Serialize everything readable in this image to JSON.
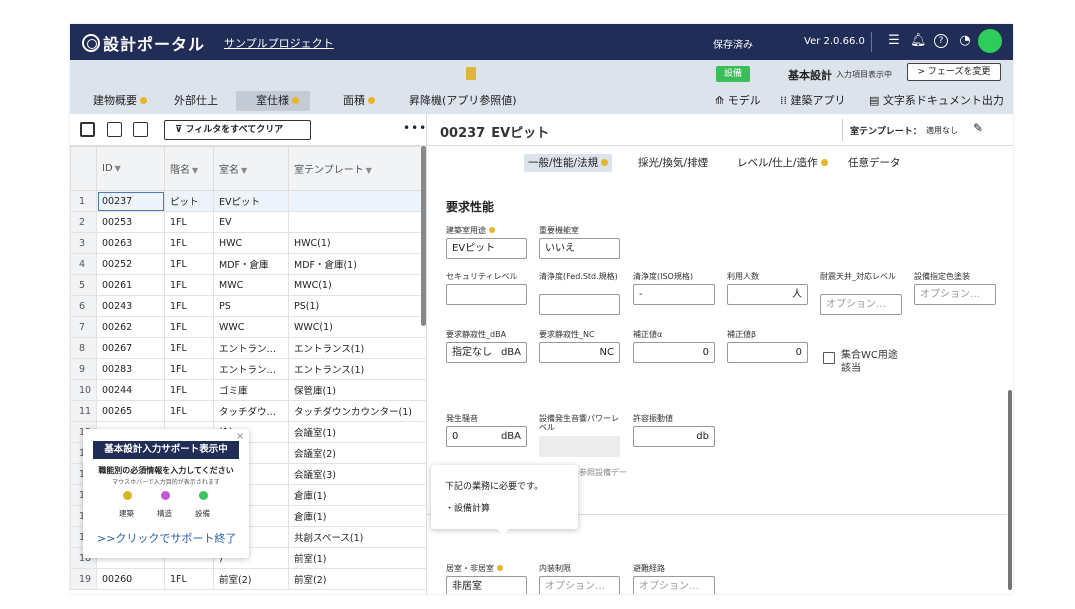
{
  "header": {
    "app_title": "設計ポータル",
    "project_link": "サンプルプロジェクト",
    "save_status": "保存済み",
    "version": "Ver 2.0.66.0",
    "icons": [
      "menu-icon",
      "bell-icon",
      "help-icon",
      "history-icon",
      "avatar"
    ]
  },
  "subheader": {
    "badge": "設備",
    "phase_title": "基本設計",
    "phase_sub": "入力項目表示中",
    "phase_button": "フェーズを変更",
    "tabs": [
      "建物概要",
      "外部仕上",
      "室仕様",
      "面積",
      "昇降機(アプリ参照値)"
    ],
    "active_tab": "室仕様",
    "links": [
      "モデル",
      "建築アプリ",
      "文字系ドキュメント出力"
    ]
  },
  "left_toolbar": {
    "filter_clear": "フィルタをすべてクリア",
    "more": "•••"
  },
  "table": {
    "columns": [
      "ID",
      "階名",
      "室名",
      "室テンプレート"
    ],
    "rows": [
      {
        "n": "1",
        "id": "00237",
        "floor": "ピット",
        "room": "EVピット",
        "template": ""
      },
      {
        "n": "2",
        "id": "00253",
        "floor": "1FL",
        "room": "EV",
        "template": ""
      },
      {
        "n": "3",
        "id": "00263",
        "floor": "1FL",
        "room": "HWC",
        "template": "HWC(1)"
      },
      {
        "n": "4",
        "id": "00252",
        "floor": "1FL",
        "room": "MDF・倉庫",
        "template": "MDF・倉庫(1)"
      },
      {
        "n": "5",
        "id": "00261",
        "floor": "1FL",
        "room": "MWC",
        "template": "MWC(1)"
      },
      {
        "n": "6",
        "id": "00243",
        "floor": "1FL",
        "room": "PS",
        "template": "PS(1)"
      },
      {
        "n": "7",
        "id": "00262",
        "floor": "1FL",
        "room": "WWC",
        "template": "WWC(1)"
      },
      {
        "n": "8",
        "id": "00267",
        "floor": "1FL",
        "room": "エントラン…",
        "template": "エントランス(1)"
      },
      {
        "n": "9",
        "id": "00283",
        "floor": "1FL",
        "room": "エントラン…",
        "template": "エントランス(1)"
      },
      {
        "n": "10",
        "id": "00244",
        "floor": "1FL",
        "room": "ゴミ庫",
        "template": "保管庫(1)"
      },
      {
        "n": "11",
        "id": "00265",
        "floor": "1FL",
        "room": "タッチダウ…",
        "template": "タッチダウンカウンター(1)"
      },
      {
        "n": "12",
        "id": "",
        "floor": "",
        "room": "(1)",
        "template": "会議室(1)"
      },
      {
        "n": "13",
        "id": "",
        "floor": "",
        "room": "(2)",
        "template": "会議室(2)"
      },
      {
        "n": "14",
        "id": "",
        "floor": "",
        "room": "(3)",
        "template": "会議室(3)"
      },
      {
        "n": "15",
        "id": "",
        "floor": "",
        "room": ")",
        "template": "倉庫(1)"
      },
      {
        "n": "16",
        "id": "",
        "floor": "",
        "room": ")",
        "template": "倉庫(1)"
      },
      {
        "n": "17",
        "id": "",
        "floor": "",
        "room": "ペース",
        "template": "共創スペース(1)"
      },
      {
        "n": "18",
        "id": "",
        "floor": "",
        "room": ")",
        "template": "前室(1)"
      },
      {
        "n": "19",
        "id": "00260",
        "floor": "1FL",
        "room": "前室(2)",
        "template": "前室(2)"
      }
    ]
  },
  "support_popup": {
    "close": "×",
    "title": "基本設計入力サポート表示中",
    "line1": "職能別の必須情報を入力してください",
    "line2": "マウスホバーで入力目的が表示されます",
    "legend": [
      {
        "label": "建築",
        "color": "#d9b52a"
      },
      {
        "label": "構造",
        "color": "#c25ad3"
      },
      {
        "label": "設備",
        "color": "#39c45c"
      }
    ],
    "end_link": ">>クリックでサポート終了"
  },
  "detail": {
    "room_id": "00237",
    "room_name": "EVピット",
    "template_label": "室テンプレート：",
    "template_value": "適用なし",
    "tabs": [
      "一般/性能/法規",
      "採光/換気/排煙",
      "レベル/仕上/造作",
      "任意データ"
    ],
    "section_title": "要求性能",
    "fields": {
      "usage_label": "建築室用途",
      "usage_value": "EVピット",
      "important_label": "重要機能室",
      "important_value": "いいえ",
      "security_label": "セキュリティレベル",
      "clean_fed_label": "清浄度(Fed.Std.規格)",
      "clean_iso_label": "清浄度(ISO規格)",
      "clean_iso_value": "-",
      "users_label": "利用人数",
      "users_unit": "人",
      "ceiling_label": "耐震天井_対応レベル",
      "ceiling_ph": "オプション…",
      "color_label": "設備指定色塗装",
      "color_ph": "オプション…",
      "quiet_dba_label": "要求静寂性_dBA",
      "quiet_dba_value": "指定なし",
      "quiet_dba_unit": "dBA",
      "quiet_nc_label": "要求静寂性_NC",
      "quiet_nc_unit": "NC",
      "corr_a_label": "補正値α",
      "corr_a_value": "0",
      "corr_b_label": "補正値β",
      "corr_b_value": "0",
      "wc_check_label": "集合WC用途該当",
      "noise_label": "発生騒音",
      "noise_value": "0",
      "noise_unit": "dBA",
      "equip_noise_label": "設備発生音響パワーレベル",
      "auto_note": "自動入力：参照設備データから",
      "vib_label": "許容振動値",
      "vib_unit": "db",
      "living_label": "居室・非居室",
      "living_value": "非居室",
      "interior_label": "内装制限",
      "interior_ph": "オプション…",
      "evac_label": "避難経路",
      "evac_ph": "オプション…"
    }
  },
  "tooltip": {
    "line1": "下記の業務に必要です。",
    "line2": "・設備計算"
  }
}
